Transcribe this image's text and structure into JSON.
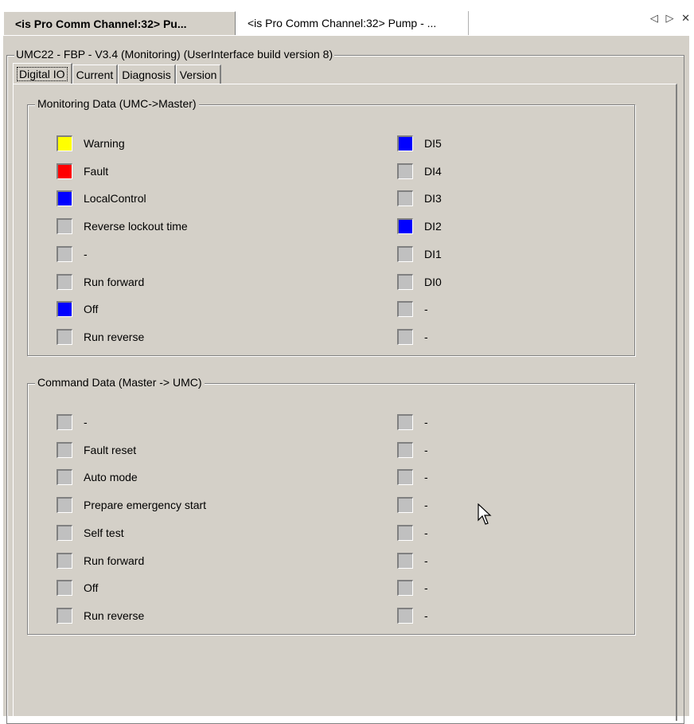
{
  "tabs_bar": {
    "tab1": "<is Pro Comm Channel:32> Pu...",
    "tab2": "<is Pro Comm Channel:32> Pump - ...",
    "nav_arrows": "◁ ▷ ✕"
  },
  "group_title": "UMC22 - FBP - V3.4 (Monitoring) (UserInterface build version 8)",
  "tabs": [
    "Digital IO",
    "Current",
    "Diagnosis",
    "Version"
  ],
  "colors": {
    "yellow": "#ffff00",
    "red": "#ff0000",
    "blue": "#0000ff",
    "off": "#c0c0c0"
  },
  "monitoring": {
    "title": "Monitoring Data (UMC->Master)",
    "left": [
      {
        "label": "Warning",
        "state": "yellow"
      },
      {
        "label": "Fault",
        "state": "red"
      },
      {
        "label": "LocalControl",
        "state": "blue"
      },
      {
        "label": "Reverse lockout time",
        "state": "off"
      },
      {
        "label": "-",
        "state": "off"
      },
      {
        "label": "Run forward",
        "state": "off"
      },
      {
        "label": "Off",
        "state": "blue"
      },
      {
        "label": "Run reverse",
        "state": "off"
      }
    ],
    "right": [
      {
        "label": "DI5",
        "state": "blue"
      },
      {
        "label": "DI4",
        "state": "off"
      },
      {
        "label": "DI3",
        "state": "off"
      },
      {
        "label": "DI2",
        "state": "blue"
      },
      {
        "label": "DI1",
        "state": "off"
      },
      {
        "label": "DI0",
        "state": "off"
      },
      {
        "label": "-",
        "state": "off"
      },
      {
        "label": "-",
        "state": "off"
      }
    ]
  },
  "command": {
    "title": "Command Data (Master -> UMC)",
    "left": [
      {
        "label": "-",
        "state": "off"
      },
      {
        "label": "Fault reset",
        "state": "off"
      },
      {
        "label": "Auto mode",
        "state": "off"
      },
      {
        "label": "Prepare emergency start",
        "state": "off"
      },
      {
        "label": "Self test",
        "state": "off"
      },
      {
        "label": "Run forward",
        "state": "off"
      },
      {
        "label": "Off",
        "state": "off"
      },
      {
        "label": "Run reverse",
        "state": "off"
      }
    ],
    "right": [
      {
        "label": "-",
        "state": "off"
      },
      {
        "label": "-",
        "state": "off"
      },
      {
        "label": "-",
        "state": "off"
      },
      {
        "label": "-",
        "state": "off"
      },
      {
        "label": "-",
        "state": "off"
      },
      {
        "label": "-",
        "state": "off"
      },
      {
        "label": "-",
        "state": "off"
      },
      {
        "label": "-",
        "state": "off"
      }
    ]
  }
}
